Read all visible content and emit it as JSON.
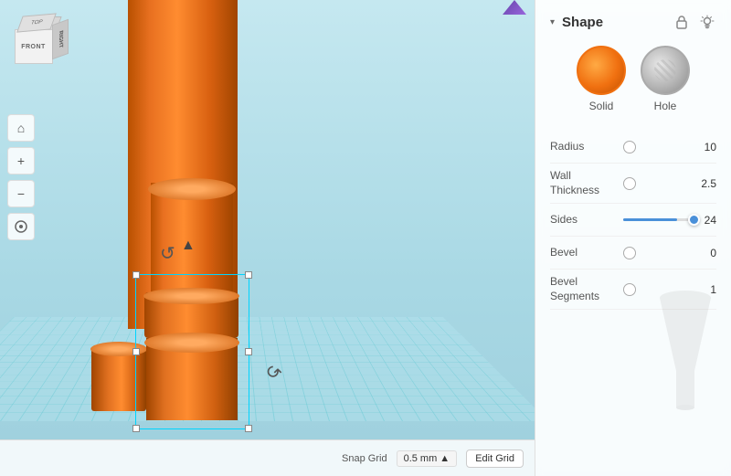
{
  "viewport": {
    "view_label": "RIGHT"
  },
  "toolbar": {
    "home_label": "⌂",
    "zoom_in_label": "+",
    "zoom_out_label": "−",
    "orient_label": "⊙",
    "rotate_label": "↻"
  },
  "panel": {
    "title": "Shape",
    "collapse_icon": "▾",
    "lock_icon": "🔒",
    "light_icon": "💡",
    "shape_solid_label": "Solid",
    "shape_hole_label": "Hole",
    "properties": [
      {
        "label": "Radius",
        "type": "radio",
        "value": "10"
      },
      {
        "label": "Wall\nThickness",
        "type": "radio",
        "value": "2.5"
      },
      {
        "label": "Sides",
        "type": "slider",
        "value": "24",
        "fill_pct": 75
      },
      {
        "label": "Bevel",
        "type": "radio",
        "value": "0"
      },
      {
        "label": "Bevel\nSegments",
        "type": "radio",
        "value": "1"
      }
    ]
  },
  "bottom_bar": {
    "edit_grid_label": "Edit Grid",
    "snap_label": "Snap Grid",
    "snap_value": "0.5 mm ▲"
  }
}
